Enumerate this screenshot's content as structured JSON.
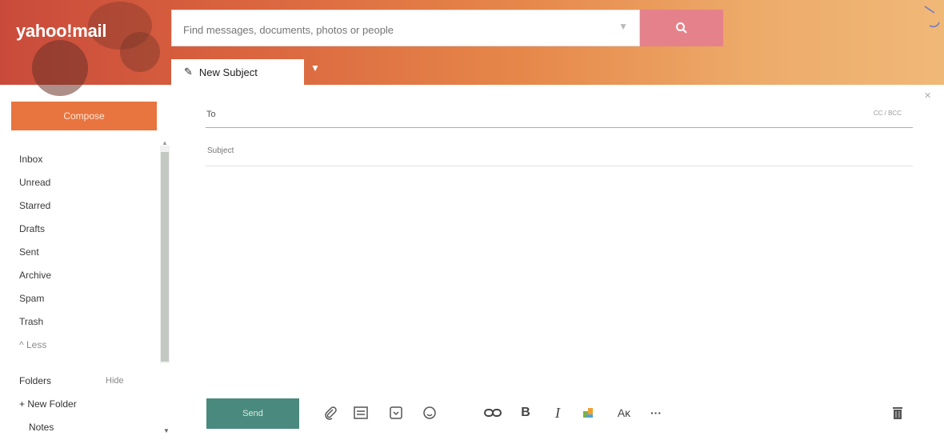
{
  "app": {
    "logo": "yahoo!mail"
  },
  "search": {
    "placeholder": "Find messages, documents, photos or people"
  },
  "tabs": [
    {
      "label": "New Subject"
    }
  ],
  "sidebar": {
    "compose_label": "Compose",
    "items": [
      {
        "label": "Inbox"
      },
      {
        "label": "Unread"
      },
      {
        "label": "Starred"
      },
      {
        "label": "Drafts"
      },
      {
        "label": "Sent"
      },
      {
        "label": "Archive"
      },
      {
        "label": "Spam"
      },
      {
        "label": "Trash"
      },
      {
        "label": "^ Less"
      }
    ],
    "folders_label": "Folders",
    "folders_hide": "Hide",
    "new_folder": "+ New Folder",
    "notes": "Notes"
  },
  "compose": {
    "to_label": "To",
    "cc_bcc": "CC / BCC",
    "subject_placeholder": "Subject",
    "send_label": "Send"
  },
  "toolbar_icons": [
    "paperclip-icon",
    "image-icon",
    "sticker-icon",
    "emoji-icon",
    "link-icon",
    "bold-icon",
    "italic-icon",
    "color-icon",
    "font-size-icon",
    "more-icon",
    "trash-icon"
  ],
  "colors": {
    "compose_button": "#e8743f",
    "send_button": "#4a8a7e",
    "search_button": "#e4818a",
    "header_start": "#c94a3b",
    "header_end": "#f0b877"
  }
}
